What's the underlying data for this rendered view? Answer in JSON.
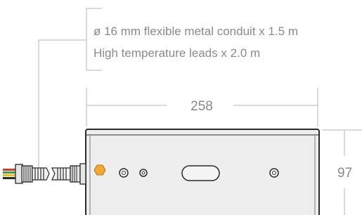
{
  "annotation": {
    "line1": "ø 16 mm flexible metal conduit x 1.5 m",
    "line2": "High temperature leads x 2.0 m"
  },
  "dimensions": {
    "width_label": "258",
    "height_label": "97"
  },
  "colors": {
    "dim_line": "#b4b4b4",
    "text": "#8a8a8a",
    "body_fill": "#eeeeee",
    "body_stroke": "#2a2a2a",
    "status_light": "#f0a830"
  },
  "parts": {
    "status_light_icon": "hexagon-indicator",
    "port_icon": "round-port",
    "slot_icon": "rounded-slot",
    "connector_icon": "threaded-connector",
    "conduit_icon": "flexible-conduit",
    "lead_wire_colors": [
      "#d23a2a",
      "#3aa04a",
      "#f0c020",
      "#2a2a2a"
    ]
  }
}
